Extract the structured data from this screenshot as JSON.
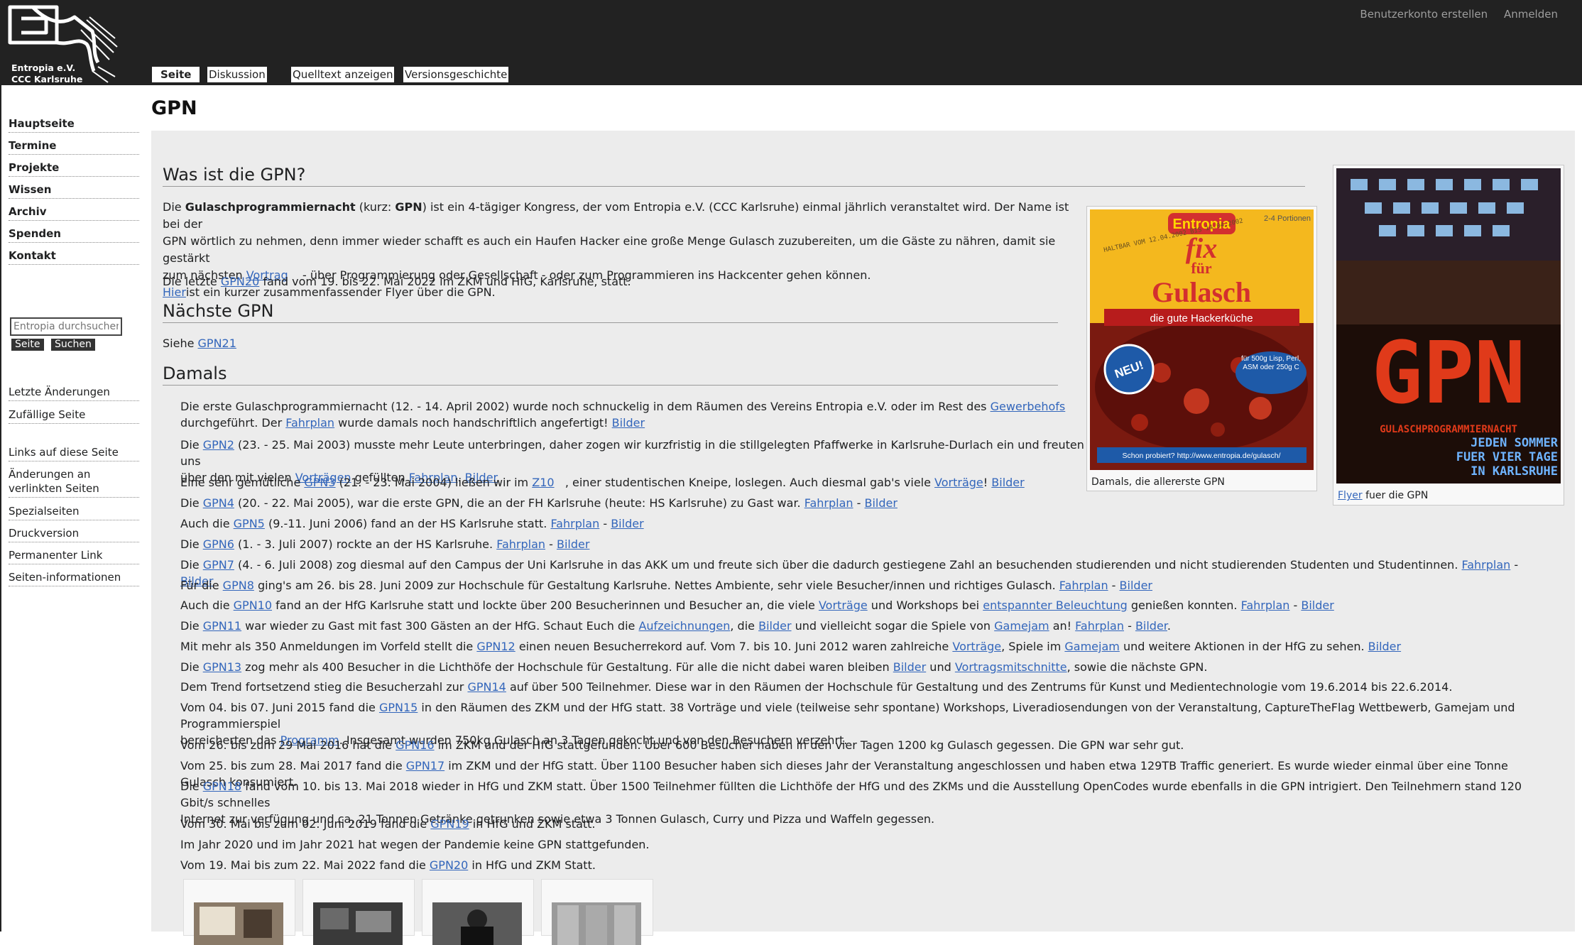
{
  "header": {
    "logo_text_line1": "Entropia e.V.",
    "logo_text_line2": "CCC Karlsruhe",
    "personal": [
      "Benutzerkonto erstellen",
      "Anmelden"
    ],
    "tabs": [
      "Seite",
      "Diskussion",
      "Quelltext anzeigen",
      "Versionsgeschichte"
    ]
  },
  "sidebar": {
    "nav": [
      "Hauptseite",
      "Termine",
      "Projekte",
      "Wissen",
      "Archiv",
      "Spenden",
      "Kontakt"
    ],
    "search_placeholder": "Entropia durchsuchen",
    "search_buttons": [
      "Seite",
      "Suchen"
    ],
    "tools1": [
      "Letzte Änderungen",
      "Zufällige Seite"
    ],
    "tools2": [
      "Links auf diese Seite",
      "Änderungen an verlinkten Seiten",
      "Spezialseiten",
      "Druckversion",
      "Permanenter Link",
      "Seiten-informationen"
    ]
  },
  "page": {
    "title": "GPN",
    "h_was": "Was ist die GPN?",
    "h_naechste": "Nächste GPN",
    "h_damals": "Damals",
    "intro_1": "Die",
    "intro_bold1": "Gulaschprogrammiernacht",
    "intro_2": "(kurz:",
    "intro_bold2": "GPN",
    "intro_3": ") ist ein 4-tägiger Kongress, der vom Entropia e.V. (CCC Karlsruhe) einmal jährlich veranstaltet wird. Der Name ist bei der",
    "intro_line2": "GPN wörtlich zu nehmen, denn immer wieder schafft es auch ein Haufen Hacker eine große Menge Gulasch zuzubereiten, um die Gäste zu nähren, damit sie gestärkt",
    "intro_line3a": "zum nächsten",
    "intro_line3_link": "Vortrag",
    "intro_line3b": "- über Programmierung oder Gesellschaft - oder zum Programmieren ins Hackcenter gehen können.",
    "intro_hier": "Hier",
    "intro_hier_rest": "ist ein kurzer zusammenfassender Flyer über die GPN.",
    "letzte_a": "Die letzte",
    "letzte_link": "GPN20",
    "letzte_b": "fand vom 19. bis 22. Mai 2022 im ZKM und HfG, Karlsruhe, statt.",
    "siehe": "Siehe",
    "siehe_link": "GPN21",
    "thumb1_caption": "Damals, die allererste GPN",
    "thumb2_caption_link": "Flyer",
    "thumb2_caption_rest": "fuer die GPN",
    "packet": {
      "brand": "Entropia",
      "fix": "fix",
      "fuer": "für",
      "gulasch": "Gulasch",
      "sub": "die gute Hackerküche",
      "portion": "2-4 Portionen",
      "stamp": "HALTBAR VOM 12.04.2002 BIS 14.04.2002",
      "neu": "NEU!",
      "fuer500": "für 500g Lisp, Perl, ASM oder 250g C",
      "url": "Schon probiert? http://www.entropia.de/gulasch/"
    },
    "poster": {
      "big": "GPN",
      "line1": "GULASCHPROGRAMMIERNACHT",
      "line2": "JEDEN SOMMER",
      "line3": "FUER VIER TAGE",
      "line4": "IN KARLSRUHE"
    },
    "damals": [
      {
        "t1": "Die erste Gulaschprogrammiernacht (12. - 14. April 2002) wurde noch schnuckelig in dem Räumen des Vereins Entropia e.V. oder im Rest des",
        "l1": "Gewerbehofs",
        "t2": "durchgeführt. Der",
        "l2": "Fahrplan",
        "t3": "wurde damals noch handschriftlich angefertigt!",
        "l3": "Bilder"
      },
      {
        "t1": "Die",
        "l1": "GPN2",
        "t2": "(23. - 25. Mai 2003) musste mehr Leute unterbringen, daher zogen wir kurzfristig in die stillgelegten Pfaffwerke in Karlsruhe-Durlach ein und freuten uns",
        "t3": "über den mit vielen",
        "l2": "Vorträgen",
        "t4": "gefüllten",
        "l3": "Fahrplan",
        "l4": "Bilder"
      },
      {
        "t1": "Eine sehr gemütliche",
        "l1": "GPN3",
        "t2": "(21. - 23. Mai 2004) ließen wir im",
        "l2": "Z10",
        "t3": ", einer studentischen Kneipe, loslegen. Auch diesmal gab's viele",
        "l3": "Vorträge",
        "l4": "Bilder"
      },
      {
        "t1": "Die",
        "l1": "GPN4",
        "t2": "(20. - 22. Mai 2005), war die erste GPN, die an der FH Karlsruhe (heute: HS Karlsruhe) zu Gast war.",
        "l2": "Fahrplan",
        "l3": "Bilder"
      },
      {
        "t1": "Auch die",
        "l1": "GPN5",
        "t2": "(9.-11. Juni 2006) fand an der HS Karlsruhe statt.",
        "l2": "Fahrplan",
        "l3": "Bilder"
      },
      {
        "t1": "Die",
        "l1": "GPN6",
        "t2": "(1. - 3. Juli 2007) rockte an der HS Karlsruhe.",
        "l2": "Fahrplan",
        "l3": "Bilder"
      },
      {
        "t1": "Die",
        "l1": "GPN7",
        "t2": "(4. - 6. Juli 2008) zog diesmal auf den Campus der Uni Karlsruhe in das AKK um und freute sich über die dadurch gestiegene Zahl an besuchenden studierenden und nicht studierenden Studenten und Studentinnen.",
        "l2": "Fahrplan",
        "l3": "Bilder"
      },
      {
        "t1": "Für die",
        "l1": "GPN8",
        "t2": "ging's am 26. bis 28. Juni 2009 zur Hochschule für Gestaltung Karlsruhe. Nettes Ambiente, sehr viele Besucher/innen und richtiges Gulasch.",
        "l2": "Fahrplan",
        "l3": "Bilder"
      },
      {
        "t1": "Auch die",
        "l1": "GPN10",
        "t2": "fand an der HfG Karlsruhe statt und lockte über 200 Besucherinnen und Besucher an, die viele",
        "l2": "Vorträge",
        "t3": "und Workshops bei",
        "l3": "entspannter Beleuchtung",
        "t4": "genießen konnten.",
        "l4": "Fahrplan",
        "l5": "Bilder"
      },
      {
        "t1": "Die",
        "l1": "GPN11",
        "t2": "war wieder zu Gast mit fast 300 Gästen an der HfG. Schaut Euch die",
        "l2": "Aufzeichnungen",
        "t3": ", die",
        "l3": "Bilder",
        "t4": "und vielleicht sogar die Spiele von",
        "l4": "Gamejam",
        "t5": "an!",
        "l5": "Fahrplan",
        "l6": "Bilder"
      },
      {
        "t1": "Mit mehr als 350 Anmeldungen im Vorfeld stellt die",
        "l1": "GPN12",
        "t2": "einen neuen Besucherrekord auf. Vom 7. bis 10. Juni 2012 waren zahlreiche",
        "l2": "Vorträge",
        "t3": ", Spiele im",
        "l3": "Gamejam",
        "t4": "und weitere Aktionen in der HfG zu sehen.",
        "l4": "Bilder"
      },
      {
        "t1": "Die",
        "l1": "GPN13",
        "t2": "zog mehr als 400 Besucher in die Lichthöfe der Hochschule für Gestaltung. Für alle die nicht dabei waren bleiben",
        "l2": "Bilder",
        "t3": "und",
        "l3": "Vortragsmitschnitte",
        "t4": ", sowie die nächste GPN."
      },
      {
        "t1": "Dem Trend fortsetzend stieg die Besucherzahl zur",
        "l1": "GPN14",
        "t2": "auf über 500 Teilnehmer. Diese war in den Räumen der Hochschule für Gestaltung und des Zentrums für Kunst und Medientechnologie vom 19.6.2014 bis 22.6.2014."
      },
      {
        "t1": "Vom 04. bis 07. Juni 2015 fand die",
        "l1": "GPN15",
        "t2": "in den Räumen des ZKM und der HfG statt. 38 Vorträge und viele (teilweise sehr spontane) Workshops, Liveradiosendungen von der Veranstaltung, CaptureTheFlag Wettbewerb, Gamejam und Programmierspiel",
        "t3": "bereicherten das",
        "l2": "Programm",
        "t4": ". Insgesamt wurden 750kg Gulasch an 3 Tagen gekocht und von den Besuchern verzehrt."
      },
      {
        "t1": "Vom 26. bis zum 29 Mai 2016 hat die",
        "l1": "GPN16",
        "t2": "im ZKM und der HfG stattgefunden. Über 600 Besucher haben in den vier Tagen 1200 kg Gulasch gegessen. Die GPN war sehr gut."
      },
      {
        "t1": "Vom 25. bis zum 28. Mai 2017 fand die",
        "l1": "GPN17",
        "t2": "im ZKM und der HfG statt. Über 1100 Besucher haben sich dieses Jahr der Veranstaltung angeschlossen und haben etwa 129TB Traffic generiert. Es wurde wieder einmal über eine Tonne Gulasch konsumiert."
      },
      {
        "t1": "Die",
        "l1": "GPN18",
        "t2": "fand vom 10. bis 13. Mai 2018 wieder in HfG und ZKM statt. Über 1500 Teilnehmer füllten die Lichthöfe der HfG und des ZKMs und die Ausstellung OpenCodes wurde ebenfalls in die GPN intrigiert. Den Teilnehmern stand 120 Gbit/s schnelles",
        "t3": "Internet zur verfügung und ca. 21 Tonnen Getränke getrunken sowie etwa 3 Tonnen Gulasch, Curry und Pizza und Waffeln gegessen."
      },
      {
        "t1": "Vom 30. Mai bis zum 02. Juni 2019 fand die",
        "l1": "GPN19",
        "t2": "in HfG und ZKM statt."
      },
      {
        "t1": "Im Jahr 2020 und im Jahr 2021 hat wegen der Pandemie keine GPN stattgefunden."
      },
      {
        "t1": "Vom 19. Mai bis zum 22. Mai 2022 fand die",
        "l1": "GPN20",
        "t2": "in HfG und ZKM Statt."
      }
    ]
  },
  "colors": {
    "header_bg": "#222222",
    "content_bg": "#ececec",
    "link": "#3366bb",
    "poster_red": "#e03a1a",
    "poster_blue": "#6fb4ff"
  }
}
